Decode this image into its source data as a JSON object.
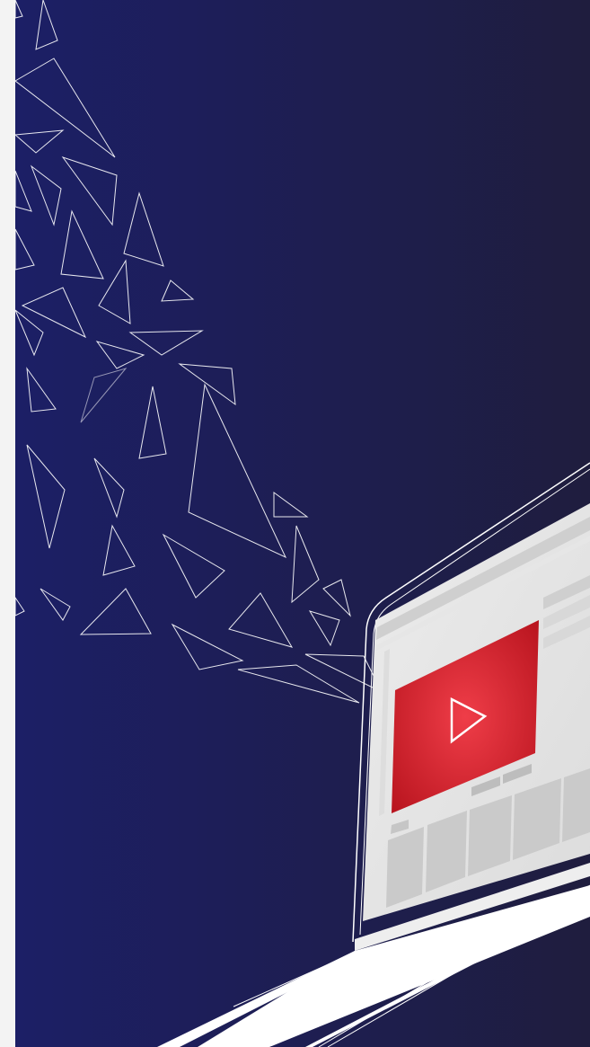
{
  "colors": {
    "bg_left": "#1c1f66",
    "bg_right": "#1f1d3e",
    "strip": "#f3f3f3",
    "shard_stroke": "#ffffff",
    "video_red": "#e0202b",
    "video_red_dark": "#b8141e",
    "screen_grey": "#d4d4d4",
    "screen_white": "#f5f5f5"
  },
  "icons": {
    "play": "play-icon"
  }
}
